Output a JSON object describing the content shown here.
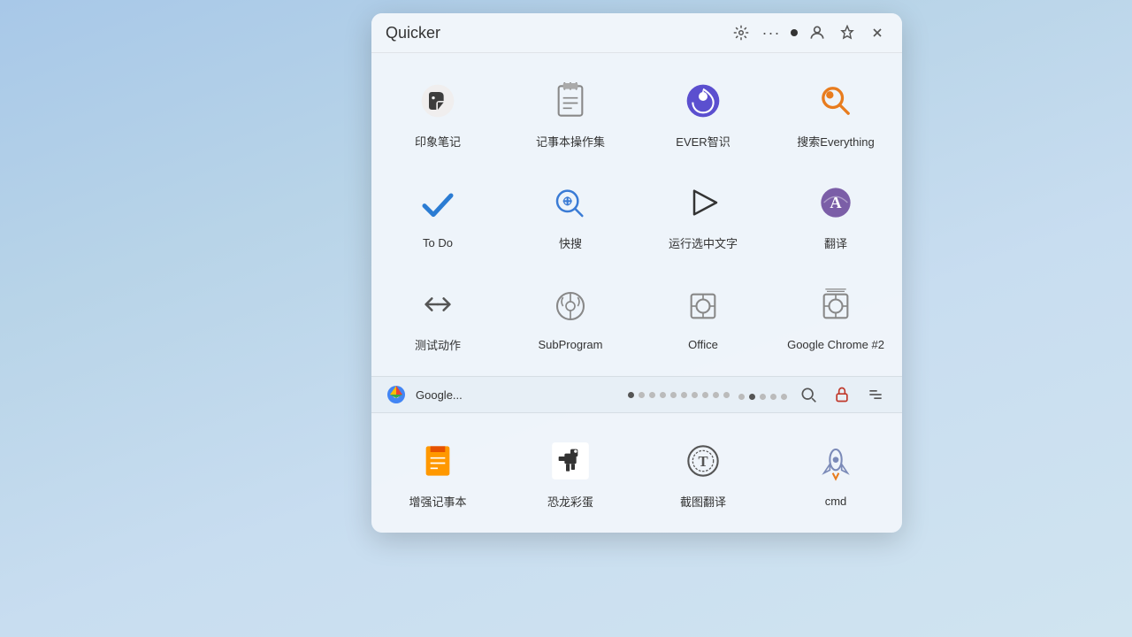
{
  "window": {
    "title": "Quicker"
  },
  "topApps": [
    {
      "id": "evernote",
      "label": "印象笔记",
      "iconType": "evernote"
    },
    {
      "id": "noteops",
      "label": "记事本操作集",
      "iconType": "note"
    },
    {
      "id": "ever",
      "label": "EVER智识",
      "iconType": "ever"
    },
    {
      "id": "search",
      "label": "搜索Everything",
      "iconType": "searchOrange"
    },
    {
      "id": "todo",
      "label": "To Do",
      "iconType": "todo"
    },
    {
      "id": "quicksearch",
      "label": "快搜",
      "iconType": "quicksearch"
    },
    {
      "id": "run",
      "label": "运行选中文字",
      "iconType": "run"
    },
    {
      "id": "translate",
      "label": "翻译",
      "iconType": "translate"
    },
    {
      "id": "test",
      "label": "测试动作",
      "iconType": "test"
    },
    {
      "id": "subprogram",
      "label": "SubProgram",
      "iconType": "subprogram"
    },
    {
      "id": "office",
      "label": "Office",
      "iconType": "office"
    },
    {
      "id": "chrome2",
      "label": "Google Chrome #2",
      "iconType": "chrome2"
    }
  ],
  "bottomApp": {
    "name": "Google...",
    "iconType": "chrome"
  },
  "lowerApps": [
    {
      "id": "notebook",
      "label": "增强记事本",
      "iconType": "notebook"
    },
    {
      "id": "dino",
      "label": "恐龙彩蛋",
      "iconType": "dino"
    },
    {
      "id": "screenshot",
      "label": "截图翻译",
      "iconType": "screenshot"
    },
    {
      "id": "cmd",
      "label": "cmd",
      "iconType": "cmd"
    }
  ],
  "pageDots": [
    true,
    false,
    false,
    false,
    false,
    false,
    false,
    false,
    false,
    false,
    false,
    false,
    false,
    false,
    false
  ]
}
